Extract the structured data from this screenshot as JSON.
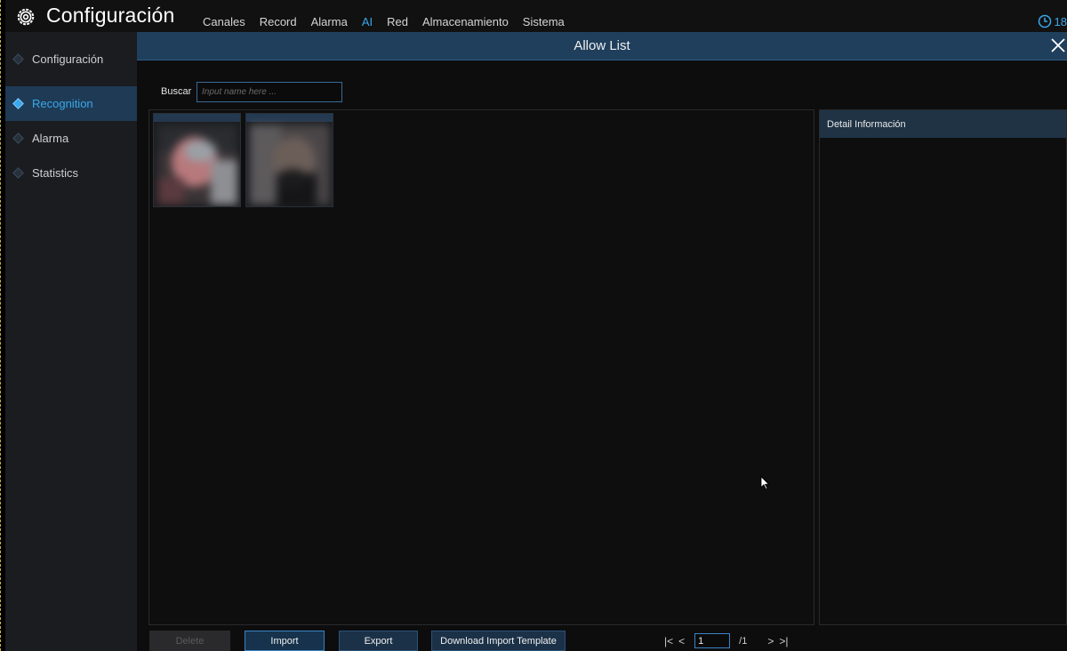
{
  "app": {
    "title": "Configuración",
    "clock_text": "18"
  },
  "menu": {
    "items": [
      {
        "label": "Canales",
        "active": false
      },
      {
        "label": "Record",
        "active": false
      },
      {
        "label": "Alarma",
        "active": false
      },
      {
        "label": "AI",
        "active": true
      },
      {
        "label": "Red",
        "active": false
      },
      {
        "label": "Almacenamiento",
        "active": false
      },
      {
        "label": "Sistema",
        "active": false
      }
    ]
  },
  "sidebar": {
    "items": [
      {
        "label": "Configuración",
        "active": false
      },
      {
        "label": "Recognition",
        "active": true
      },
      {
        "label": "Alarma",
        "active": false
      },
      {
        "label": "Statistics",
        "active": false
      }
    ]
  },
  "dialog": {
    "title": "Allow List",
    "search_label": "Buscar",
    "search_placeholder": "Input name here ...",
    "search_value": "",
    "faces": [
      {
        "thumb": "face-1"
      },
      {
        "thumb": "face-2"
      }
    ],
    "detail_title": "Detail Información"
  },
  "footer": {
    "delete_label": "Delete",
    "import_label": "Import",
    "export_label": "Export",
    "download_label": "Download Import Template"
  },
  "pagination": {
    "current_page": "1",
    "total_label": "/1"
  },
  "colors": {
    "accent": "#3aa8ea",
    "header_bar": "#1f3f5c",
    "background": "#0b0b0c"
  }
}
